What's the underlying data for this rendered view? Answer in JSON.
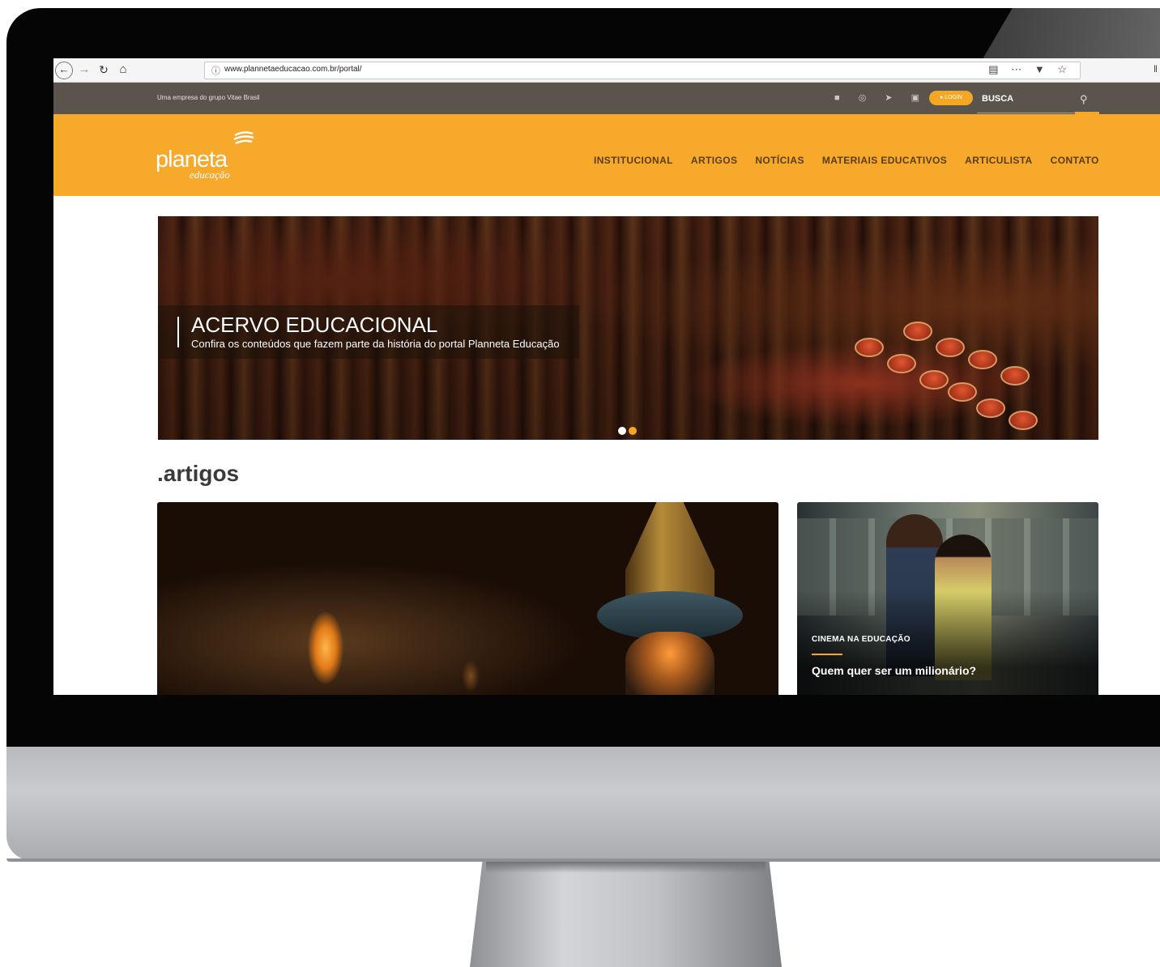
{
  "browser": {
    "url": "www.plannetaeducacao.com.br/portal/",
    "info_icon": "info-icon"
  },
  "topbar": {
    "tagline": "Uma empresa do grupo Vitae Brasil",
    "social_icons": [
      "facebook-icon",
      "instagram-icon",
      "twitter-icon",
      "linkedin-icon",
      "youtube-icon"
    ],
    "login_label": "LOGIN",
    "search_label": "BUSCA"
  },
  "header": {
    "logo_main": "planeta",
    "logo_sub": "educação",
    "menu": [
      "INSTITUCIONAL",
      "ARTIGOS",
      "NOTÍCIAS",
      "MATERIAIS EDUCATIVOS",
      "ARTICULISTA",
      "CONTATO"
    ]
  },
  "banner": {
    "title": "ACERVO EDUCACIONAL",
    "subtitle": "Confira os conteúdos que fazem parte da história do portal Planneta Educação",
    "slides_total": 2,
    "active_slide": 2
  },
  "section": {
    "title": ".artigos"
  },
  "cards": [
    {
      "category": "",
      "title": ""
    },
    {
      "category": "CINEMA NA EDUCAÇÃO",
      "title": "Quem quer ser um milionário?"
    }
  ],
  "colors": {
    "accent": "#f5a623",
    "header_bg": "#f7a92b",
    "topbar_bg": "#5b544d"
  }
}
